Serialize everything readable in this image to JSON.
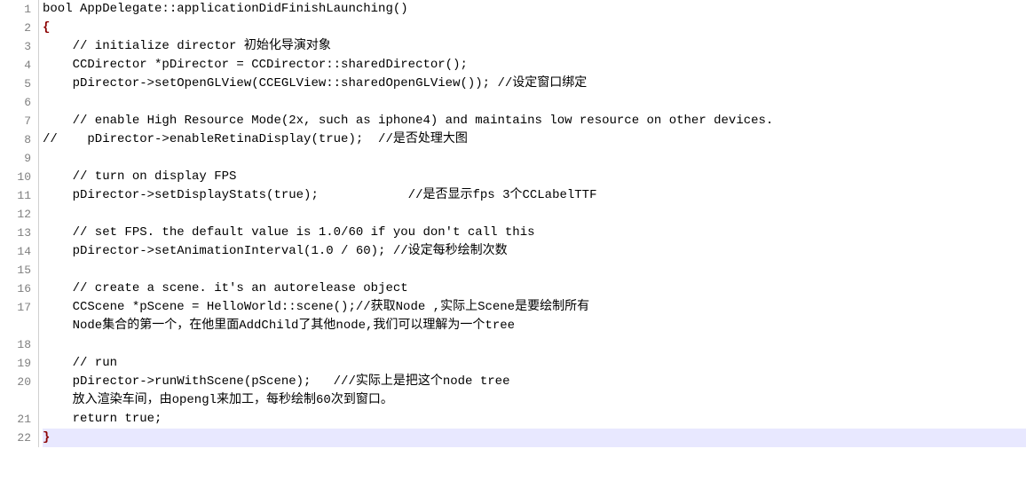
{
  "gutter": [
    "1",
    "2",
    "3",
    "4",
    "5",
    "6",
    "7",
    "8",
    "9",
    "10",
    "11",
    "12",
    "13",
    "14",
    "15",
    "16",
    "17",
    "",
    "18",
    "19",
    "20",
    "",
    "21",
    "22"
  ],
  "lines": {
    "l1": "bool AppDelegate::applicationDidFinishLaunching()",
    "l2": "{",
    "l3": "    // initialize director 初始化导演对象",
    "l4": "    CCDirector *pDirector = CCDirector::sharedDirector();",
    "l5": "    pDirector->setOpenGLView(CCEGLView::sharedOpenGLView()); //设定窗口绑定",
    "l6": "",
    "l7": "    // enable High Resource Mode(2x, such as iphone4) and maintains low resource on other devices.",
    "l8": "//    pDirector->enableRetinaDisplay(true);  //是否处理大图",
    "l9": "",
    "l10": "    // turn on display FPS",
    "l11": "    pDirector->setDisplayStats(true);            //是否显示fps 3个CCLabelTTF",
    "l12": "",
    "l13": "    // set FPS. the default value is 1.0/60 if you don't call this",
    "l14": "    pDirector->setAnimationInterval(1.0 / 60); //设定每秒绘制次数",
    "l15": "",
    "l16": "    // create a scene. it's an autorelease object",
    "l17": "    CCScene *pScene = HelloWorld::scene();//获取Node ,实际上Scene是要绘制所有",
    "l17b": "    Node集合的第一个，在他里面AddChild了其他node,我们可以理解为一个tree",
    "l18": "",
    "l19": "    // run",
    "l20": "    pDirector->runWithScene(pScene);   ///实际上是把这个node tree ",
    "l20b": "    放入渲染车间，由opengl来加工，每秒绘制60次到窗口。",
    "l21": "    return true;",
    "l22": "}"
  }
}
